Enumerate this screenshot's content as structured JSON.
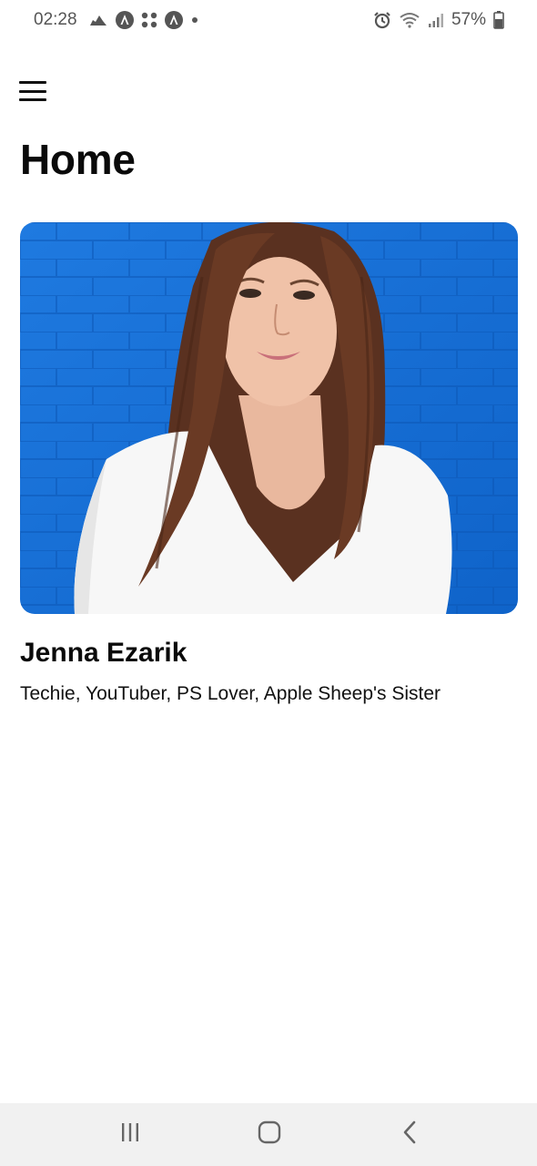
{
  "status_bar": {
    "time": "02:28",
    "battery": "57%",
    "left_icons": [
      "cloud-icon",
      "angular-icon",
      "dots-grid-icon",
      "angular-icon",
      "dot-icon"
    ],
    "right_icons": [
      "alarm-icon",
      "wifi-icon",
      "signal-icon",
      "battery-icon"
    ]
  },
  "header": {
    "title": "Home"
  },
  "profile": {
    "name": "Jenna Ezarik",
    "bio": "Techie, YouTuber, PS Lover, Apple Sheep's Sister"
  },
  "nav_bar": {
    "buttons": [
      "recent-apps",
      "home",
      "back"
    ]
  },
  "colors": {
    "photo_background": "#1670d8",
    "nav_bar_background": "#f1f1f1"
  }
}
